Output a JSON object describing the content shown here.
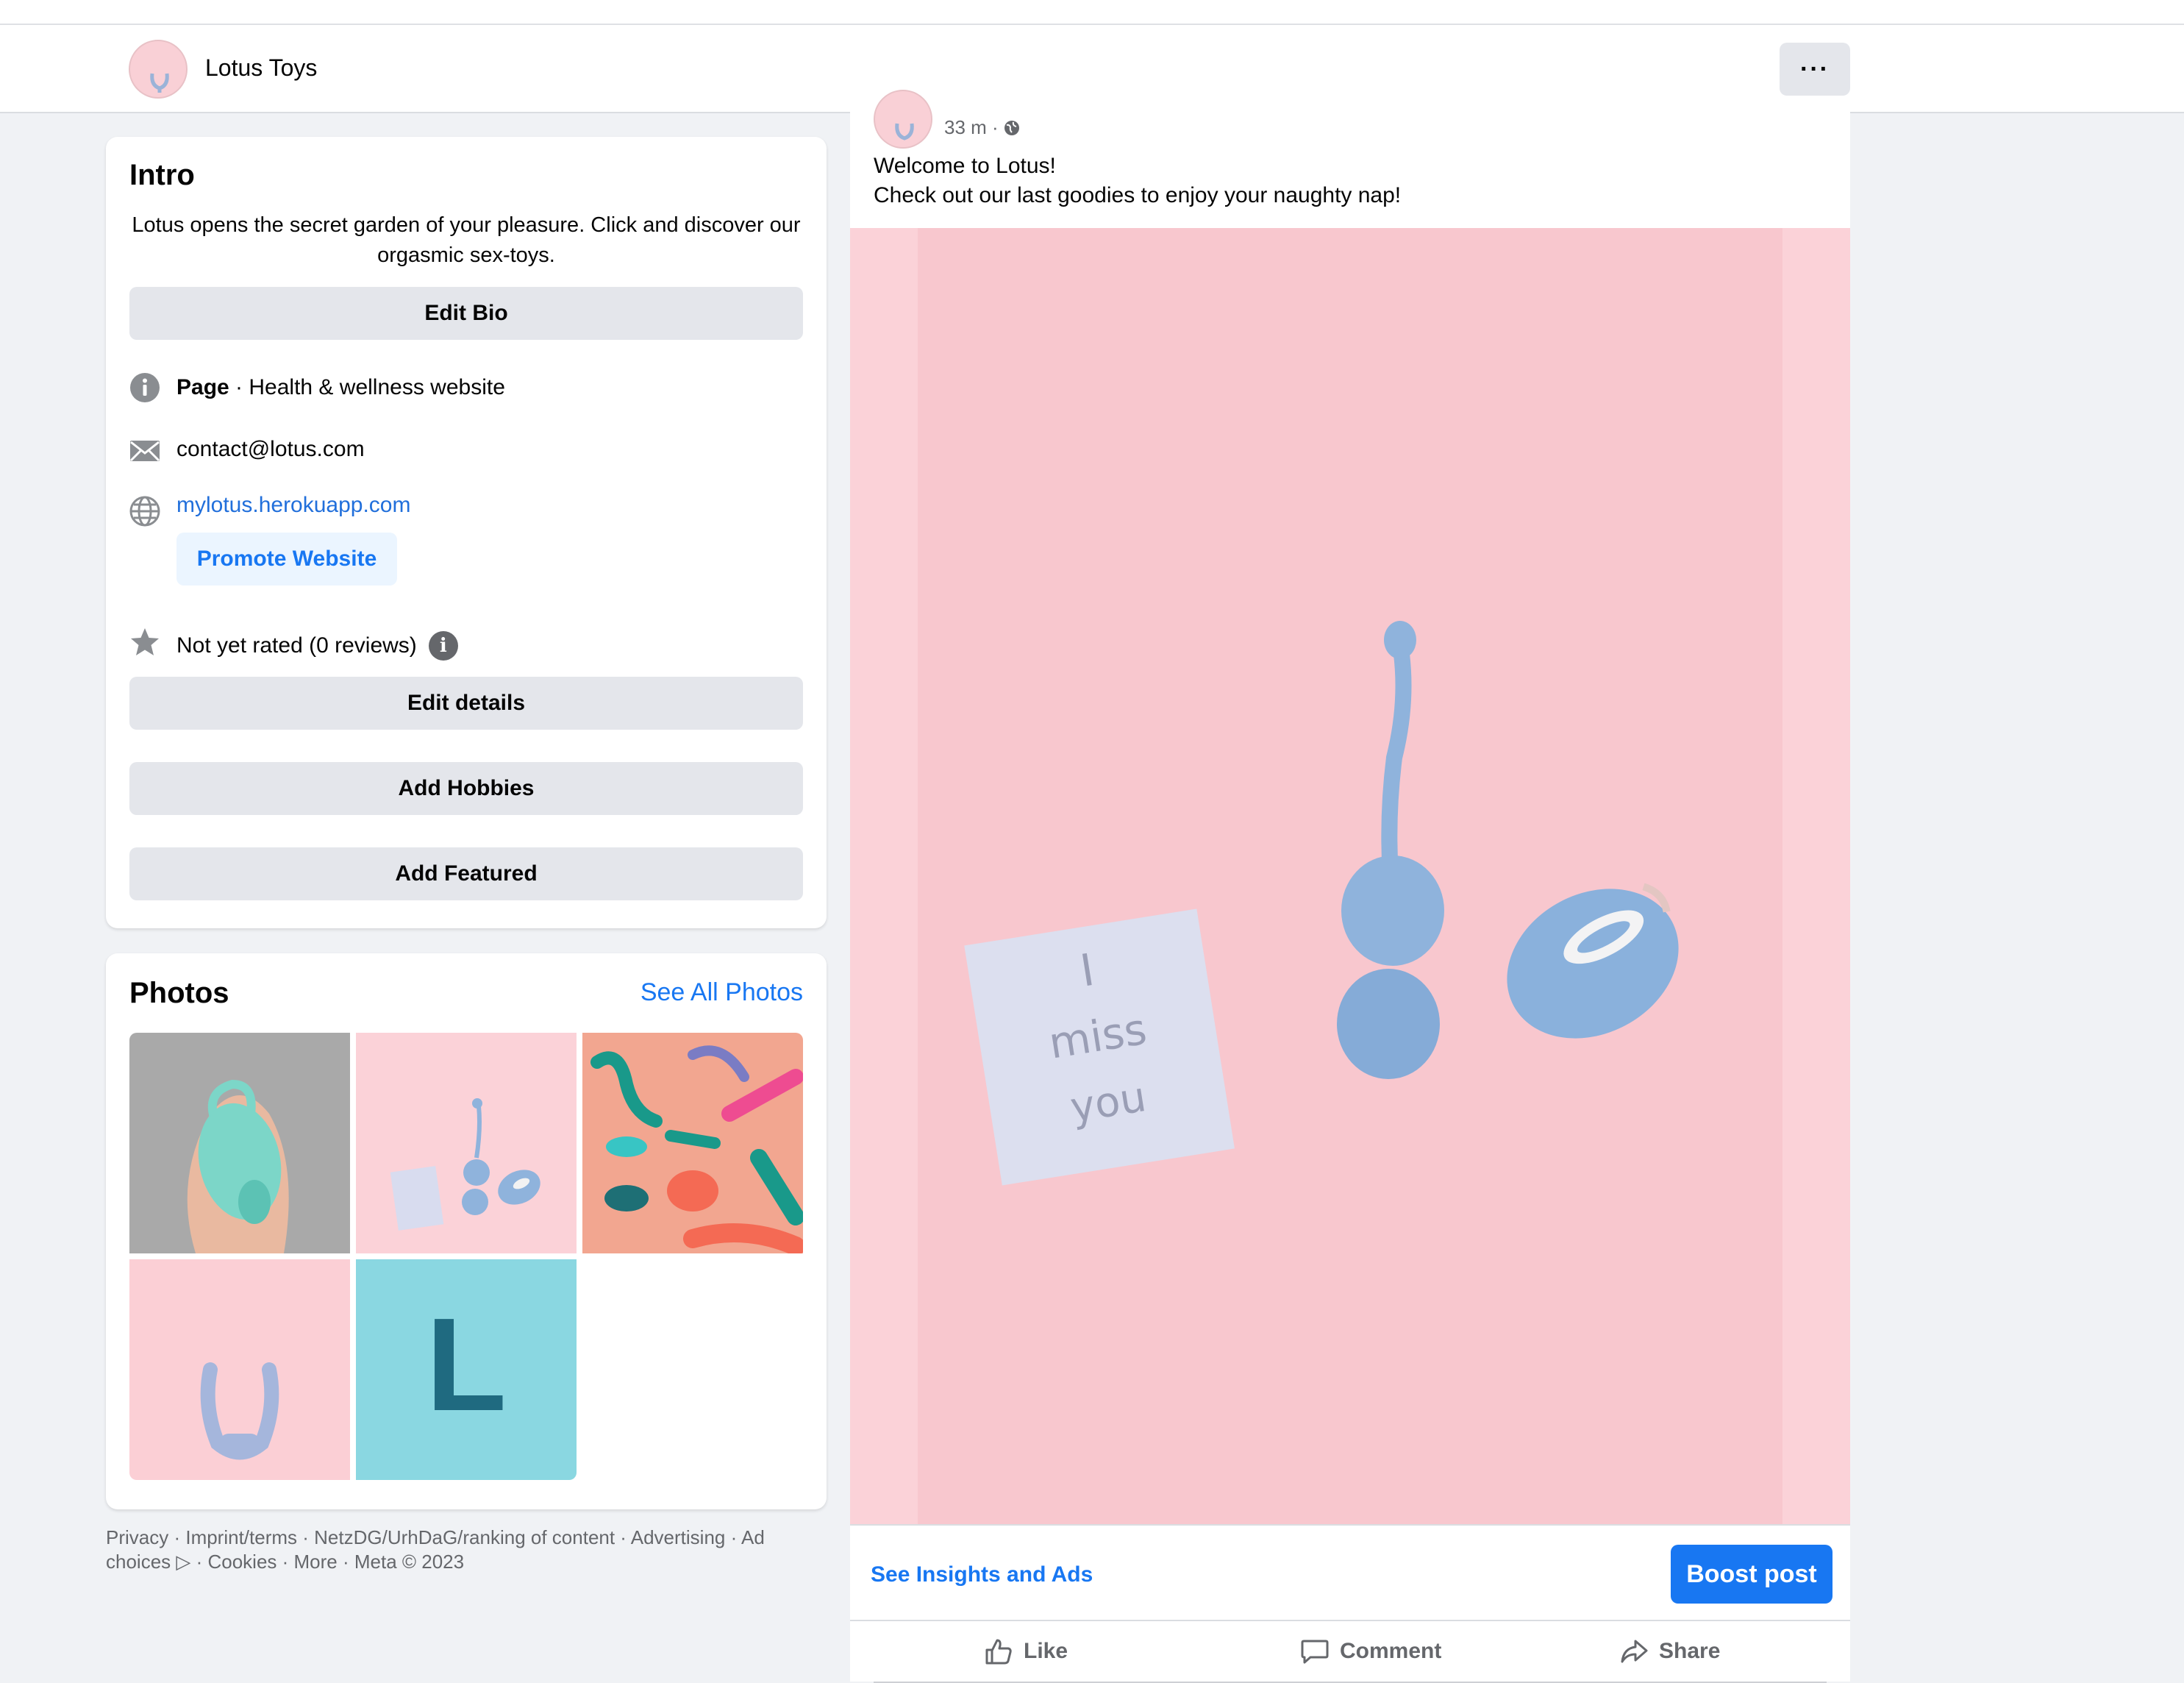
{
  "header": {
    "page_name": "Lotus Toys",
    "more_label": "···"
  },
  "intro": {
    "title": "Intro",
    "bio": "Lotus opens the secret garden of your pleasure. Click and discover our orgasmic sex-toys.",
    "edit_bio_label": "Edit Bio",
    "category_bold": "Page",
    "category_rest": " · Health & wellness website",
    "email": "contact@lotus.com",
    "website": "mylotus.herokuapp.com",
    "promote_label": "Promote Website",
    "rating": "Not yet rated (0 reviews)",
    "edit_details_label": "Edit details",
    "add_hobbies_label": "Add Hobbies",
    "add_featured_label": "Add Featured"
  },
  "photos": {
    "title": "Photos",
    "see_all_label": "See All Photos"
  },
  "footer": {
    "text": "Privacy · Imprint/terms · NetzDG/UrhDaG/ranking of content · Advertising · Ad choices ▷ · Cookies · More · Meta © 2023"
  },
  "post": {
    "time": "33 m ·",
    "line1": "Welcome to Lotus!",
    "line2": "Check out our last goodies to enjoy your naughty  nap!",
    "note_text": [
      "I",
      "miss",
      "you"
    ],
    "insights_label": "See Insights and Ads",
    "boost_label": "Boost post",
    "like_label": "Like",
    "comment_label": "Comment",
    "share_label": "Share"
  },
  "photo_tiles": {
    "tile5_letter": "L"
  },
  "colors": {
    "accent": "#1877f2",
    "pink_bg": "#fbd2d8",
    "toy_blue": "#8fb3dc",
    "teal_tile": "#8ad7e1"
  }
}
